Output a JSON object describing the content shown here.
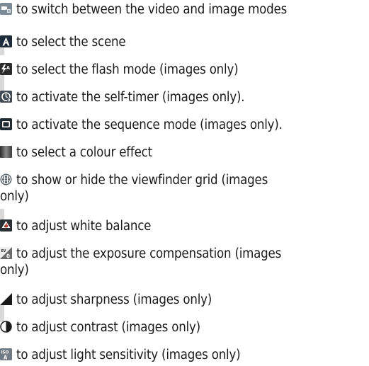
{
  "items": [
    {
      "icon": "video-image-mode-icon",
      "text": "to switch between the video and image modes",
      "text2": ""
    },
    {
      "icon": "scene-auto-icon",
      "text": "to select the scene",
      "text2": ""
    },
    {
      "icon": "flash-auto-icon",
      "text": "to select the flash mode (images only)",
      "text2": ""
    },
    {
      "icon": "self-timer-icon",
      "text": "to activate the self-timer (images only).",
      "text2": ""
    },
    {
      "icon": "sequence-mode-icon",
      "text": "to activate the sequence mode (images only).",
      "text2": ""
    },
    {
      "icon": "colour-effect-icon",
      "text": "to select a colour effect",
      "text2": ""
    },
    {
      "icon": "viewfinder-grid-icon",
      "text": "to show or hide the viewfinder grid (images",
      "text2": "only)"
    },
    {
      "icon": "white-balance-icon",
      "text": "to adjust white balance",
      "text2": ""
    },
    {
      "icon": "exposure-compensation-icon",
      "text": "to adjust the exposure compensation (images",
      "text2": "only)"
    },
    {
      "icon": "sharpness-icon",
      "text": "to adjust sharpness (images only)",
      "text2": ""
    },
    {
      "icon": "contrast-icon",
      "text": "to adjust contrast (images only)",
      "text2": ""
    },
    {
      "icon": "iso-light-sensitivity-icon",
      "text": "to adjust light sensitivity (images only)",
      "text2": ""
    }
  ]
}
